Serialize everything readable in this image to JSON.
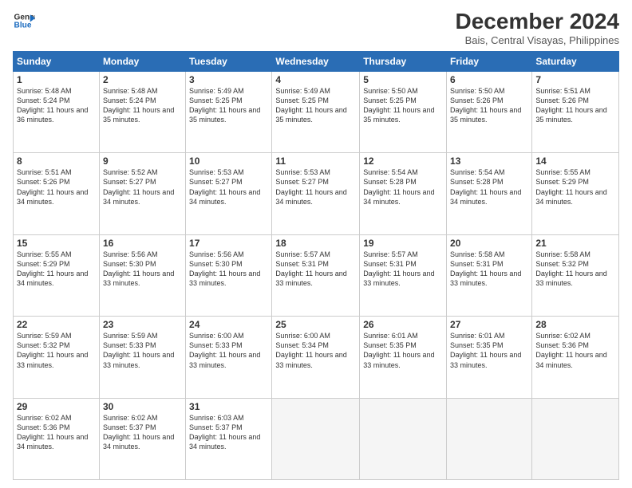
{
  "logo": {
    "line1": "General",
    "line2": "Blue"
  },
  "title": "December 2024",
  "subtitle": "Bais, Central Visayas, Philippines",
  "headers": [
    "Sunday",
    "Monday",
    "Tuesday",
    "Wednesday",
    "Thursday",
    "Friday",
    "Saturday"
  ],
  "weeks": [
    [
      {
        "day": "1",
        "sunrise": "5:48 AM",
        "sunset": "5:24 PM",
        "daylight": "11 hours and 36 minutes."
      },
      {
        "day": "2",
        "sunrise": "5:48 AM",
        "sunset": "5:24 PM",
        "daylight": "11 hours and 35 minutes."
      },
      {
        "day": "3",
        "sunrise": "5:49 AM",
        "sunset": "5:25 PM",
        "daylight": "11 hours and 35 minutes."
      },
      {
        "day": "4",
        "sunrise": "5:49 AM",
        "sunset": "5:25 PM",
        "daylight": "11 hours and 35 minutes."
      },
      {
        "day": "5",
        "sunrise": "5:50 AM",
        "sunset": "5:25 PM",
        "daylight": "11 hours and 35 minutes."
      },
      {
        "day": "6",
        "sunrise": "5:50 AM",
        "sunset": "5:26 PM",
        "daylight": "11 hours and 35 minutes."
      },
      {
        "day": "7",
        "sunrise": "5:51 AM",
        "sunset": "5:26 PM",
        "daylight": "11 hours and 35 minutes."
      }
    ],
    [
      {
        "day": "8",
        "sunrise": "5:51 AM",
        "sunset": "5:26 PM",
        "daylight": "11 hours and 34 minutes."
      },
      {
        "day": "9",
        "sunrise": "5:52 AM",
        "sunset": "5:27 PM",
        "daylight": "11 hours and 34 minutes."
      },
      {
        "day": "10",
        "sunrise": "5:53 AM",
        "sunset": "5:27 PM",
        "daylight": "11 hours and 34 minutes."
      },
      {
        "day": "11",
        "sunrise": "5:53 AM",
        "sunset": "5:27 PM",
        "daylight": "11 hours and 34 minutes."
      },
      {
        "day": "12",
        "sunrise": "5:54 AM",
        "sunset": "5:28 PM",
        "daylight": "11 hours and 34 minutes."
      },
      {
        "day": "13",
        "sunrise": "5:54 AM",
        "sunset": "5:28 PM",
        "daylight": "11 hours and 34 minutes."
      },
      {
        "day": "14",
        "sunrise": "5:55 AM",
        "sunset": "5:29 PM",
        "daylight": "11 hours and 34 minutes."
      }
    ],
    [
      {
        "day": "15",
        "sunrise": "5:55 AM",
        "sunset": "5:29 PM",
        "daylight": "11 hours and 34 minutes."
      },
      {
        "day": "16",
        "sunrise": "5:56 AM",
        "sunset": "5:30 PM",
        "daylight": "11 hours and 33 minutes."
      },
      {
        "day": "17",
        "sunrise": "5:56 AM",
        "sunset": "5:30 PM",
        "daylight": "11 hours and 33 minutes."
      },
      {
        "day": "18",
        "sunrise": "5:57 AM",
        "sunset": "5:31 PM",
        "daylight": "11 hours and 33 minutes."
      },
      {
        "day": "19",
        "sunrise": "5:57 AM",
        "sunset": "5:31 PM",
        "daylight": "11 hours and 33 minutes."
      },
      {
        "day": "20",
        "sunrise": "5:58 AM",
        "sunset": "5:31 PM",
        "daylight": "11 hours and 33 minutes."
      },
      {
        "day": "21",
        "sunrise": "5:58 AM",
        "sunset": "5:32 PM",
        "daylight": "11 hours and 33 minutes."
      }
    ],
    [
      {
        "day": "22",
        "sunrise": "5:59 AM",
        "sunset": "5:32 PM",
        "daylight": "11 hours and 33 minutes."
      },
      {
        "day": "23",
        "sunrise": "5:59 AM",
        "sunset": "5:33 PM",
        "daylight": "11 hours and 33 minutes."
      },
      {
        "day": "24",
        "sunrise": "6:00 AM",
        "sunset": "5:33 PM",
        "daylight": "11 hours and 33 minutes."
      },
      {
        "day": "25",
        "sunrise": "6:00 AM",
        "sunset": "5:34 PM",
        "daylight": "11 hours and 33 minutes."
      },
      {
        "day": "26",
        "sunrise": "6:01 AM",
        "sunset": "5:35 PM",
        "daylight": "11 hours and 33 minutes."
      },
      {
        "day": "27",
        "sunrise": "6:01 AM",
        "sunset": "5:35 PM",
        "daylight": "11 hours and 33 minutes."
      },
      {
        "day": "28",
        "sunrise": "6:02 AM",
        "sunset": "5:36 PM",
        "daylight": "11 hours and 34 minutes."
      }
    ],
    [
      {
        "day": "29",
        "sunrise": "6:02 AM",
        "sunset": "5:36 PM",
        "daylight": "11 hours and 34 minutes."
      },
      {
        "day": "30",
        "sunrise": "6:02 AM",
        "sunset": "5:37 PM",
        "daylight": "11 hours and 34 minutes."
      },
      {
        "day": "31",
        "sunrise": "6:03 AM",
        "sunset": "5:37 PM",
        "daylight": "11 hours and 34 minutes."
      },
      null,
      null,
      null,
      null
    ]
  ]
}
